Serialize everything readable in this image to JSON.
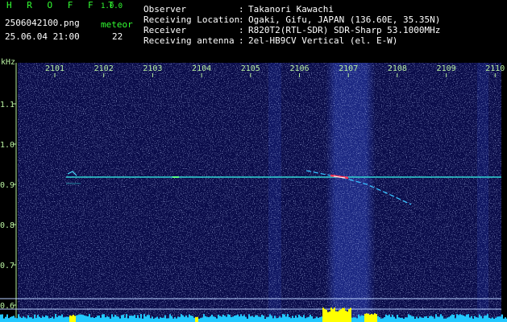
{
  "app": {
    "name": "H R O F F T",
    "version": "1.0.0"
  },
  "file": {
    "name": "2506042100.png",
    "datetime": "25.06.04 21:00"
  },
  "meteor": {
    "label": "meteor",
    "count": "22"
  },
  "info": [
    {
      "key": "Observer",
      "sep": ":",
      "value": "Takanori Kawachi"
    },
    {
      "key": "Receiving Location",
      "sep": ":",
      "value": "Ogaki, Gifu, JAPAN (136.60E, 35.35N)"
    },
    {
      "key": "Receiver",
      "sep": ":",
      "value": "R820T2(RTL-SDR) SDR-Sharp 53.1000MHz"
    },
    {
      "key": "Receiving antenna",
      "sep": ":",
      "value": "2el-HB9CV Vertical (el. E-W)"
    }
  ],
  "spectrogram": {
    "y_unit": "kHz",
    "y_ticks": [
      "1.1",
      "1.0",
      "0.9",
      "0.8",
      "0.7",
      "0.6"
    ],
    "time_ticks": [
      "2101",
      "2102",
      "2103",
      "2104",
      "2105",
      "2106",
      "2107",
      "2108",
      "2109",
      "2110"
    ],
    "colors": {
      "background": "#0a0c4a",
      "carrier": "#2fd3d3",
      "axis": "#b8f0a0",
      "level": "#22c8ff",
      "burst": "#ffff00"
    }
  }
}
